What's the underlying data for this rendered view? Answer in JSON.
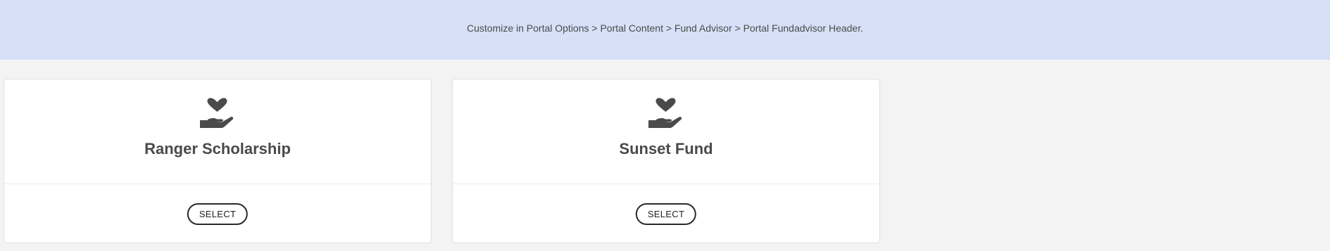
{
  "header": {
    "text": "Customize in Portal Options > Portal Content > Fund Advisor > Portal Fundadvisor Header."
  },
  "funds": [
    {
      "title": "Ranger Scholarship",
      "button_label": "SELECT",
      "icon": "hand-holding-heart-icon"
    },
    {
      "title": "Sunset Fund",
      "button_label": "SELECT",
      "icon": "hand-holding-heart-icon"
    }
  ],
  "colors": {
    "header_background": "#d6e1f7",
    "page_background": "#f3f3f3",
    "icon_color": "#4a4a4a"
  }
}
